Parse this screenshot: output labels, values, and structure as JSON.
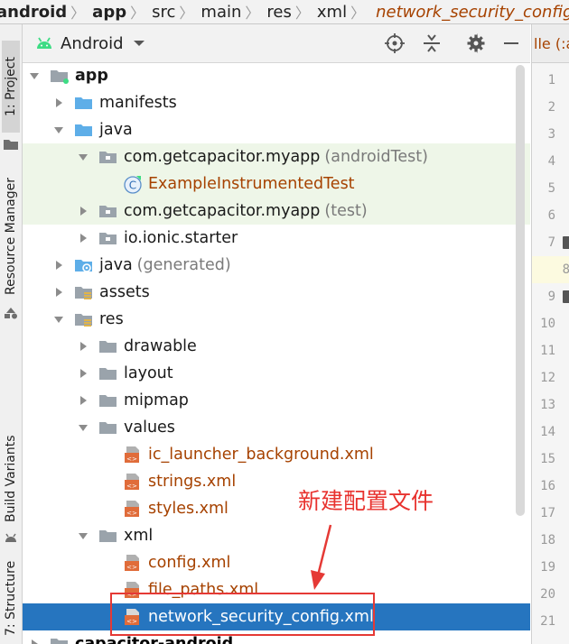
{
  "breadcrumb": {
    "items": [
      "android",
      "app",
      "src",
      "main",
      "res",
      "xml",
      "network_security_config.xml"
    ]
  },
  "tool_strip": {
    "project_tab": "1: Project",
    "resource_manager_tab": "Resource Manager",
    "build_variants_tab": "Build Variants",
    "structure_tab": "7: Structure"
  },
  "panel": {
    "view_mode": "Android"
  },
  "tree": {
    "app": "app",
    "manifests": "manifests",
    "java": "java",
    "pkg_android_test": "com.getcapacitor.myapp",
    "android_test_suffix": "(androidTest)",
    "example_test": "ExampleInstrumentedTest",
    "pkg_test": "com.getcapacitor.myapp",
    "test_suffix": "(test)",
    "io_ionic_starter": "io.ionic.starter",
    "java_generated": "java",
    "generated_suffix": "(generated)",
    "assets": "assets",
    "res": "res",
    "drawable": "drawable",
    "layout": "layout",
    "mipmap": "mipmap",
    "values": "values",
    "ic_launcher_background": "ic_launcher_background.xml",
    "strings": "strings.xml",
    "styles": "styles.xml",
    "xml": "xml",
    "config": "config.xml",
    "file_paths": "file_paths.xml",
    "network_security_config": "network_security_config.xml",
    "capacitor_android": "capacitor-android"
  },
  "editor": {
    "tab_fragment": "lle (:a",
    "line_numbers": [
      "1",
      "2",
      "3",
      "4",
      "5",
      "6",
      "7",
      "8",
      "9",
      "10",
      "11",
      "12",
      "13",
      "14",
      "15",
      "16",
      "17",
      "18",
      "19",
      "20",
      "21"
    ]
  },
  "annotation": {
    "text": "新建配置文件"
  },
  "colors": {
    "selection": "#2675bf",
    "test_highlight": "#eef6e8",
    "file_name_red": "#a64200",
    "annotation_red": "#e53935",
    "folder_blue": "#5eaee8",
    "folder_grey": "#9aa3ab"
  }
}
